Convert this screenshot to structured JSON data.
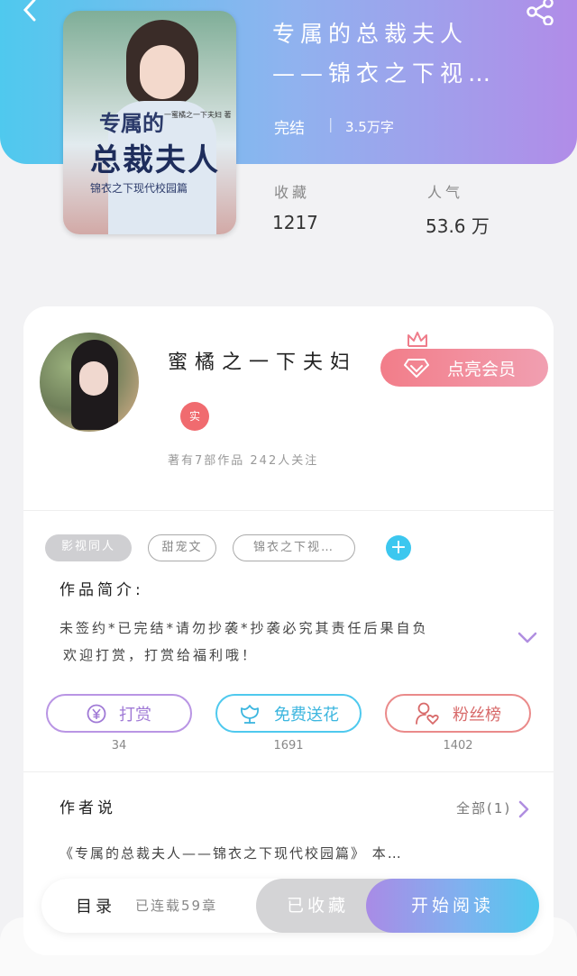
{
  "header": {
    "back_icon": "back-chevron-icon",
    "share_icon": "share-icon",
    "colors": {
      "gradient_start": "#4fc9ee",
      "gradient_end": "#b18ce8"
    }
  },
  "book": {
    "cover_title_line1": "专属的",
    "cover_title_line2": "总裁夫人",
    "cover_subtitle": "锦衣之下现代校园篇",
    "cover_small_text": "一蜜橘之一下夫妇 著",
    "title_line1": "专属的总裁夫人",
    "title_line2": "——锦衣之下视…",
    "status": "完结",
    "separator": "|",
    "word_count": "3.5万字"
  },
  "stats": {
    "favorites_label": "收藏",
    "favorites_value": "1217",
    "popularity_label": "人气",
    "popularity_value": "53.6 万"
  },
  "author": {
    "name": "蜜橘之一下夫妇",
    "badge": "实",
    "meta": "著有7部作品 242人关注",
    "vip_button": "点亮会员"
  },
  "tags": [
    "影视同人",
    "甜宠文",
    "锦衣之下视…"
  ],
  "intro": {
    "title": "作品简介:",
    "line1": "未签约*已完结*请勿抄袭*抄袭必究其责任后果自负",
    "line2": "欢迎打赏，打赏给福利哦！"
  },
  "actions": [
    {
      "label": "打赏",
      "count": "34",
      "icon": "yuan-coin-icon"
    },
    {
      "label": "免费送花",
      "count": "1691",
      "icon": "flower-icon"
    },
    {
      "label": "粉丝榜",
      "count": "1402",
      "icon": "fans-heart-icon"
    }
  ],
  "author_says": {
    "title": "作者说",
    "all_label": "全部(1)",
    "text": "《专属的总裁夫人——锦衣之下现代校园篇》 本…"
  },
  "bottom_bar": {
    "toc_label": "目录",
    "progress": "已连载59章",
    "collected": "已收藏",
    "read": "开始阅读"
  }
}
